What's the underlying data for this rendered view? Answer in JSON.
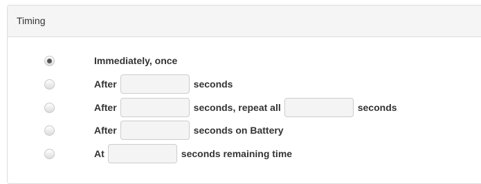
{
  "panel": {
    "title": "Timing"
  },
  "options": [
    {
      "id": "once",
      "selected": true,
      "parts": {
        "text1": "Immediately, once"
      }
    },
    {
      "id": "after",
      "selected": false,
      "parts": {
        "text1": "After",
        "value1": "",
        "text2": "seconds"
      }
    },
    {
      "id": "repeat",
      "selected": false,
      "parts": {
        "text1": "After",
        "value1": "",
        "text2": "seconds, repeat all",
        "value2": "",
        "text3": "seconds"
      }
    },
    {
      "id": "battery",
      "selected": false,
      "parts": {
        "text1": "After",
        "value1": "",
        "text2": "seconds on Battery"
      }
    },
    {
      "id": "remaining",
      "selected": false,
      "parts": {
        "text1": "At",
        "value1": "",
        "text2": "seconds remaining time"
      }
    }
  ]
}
